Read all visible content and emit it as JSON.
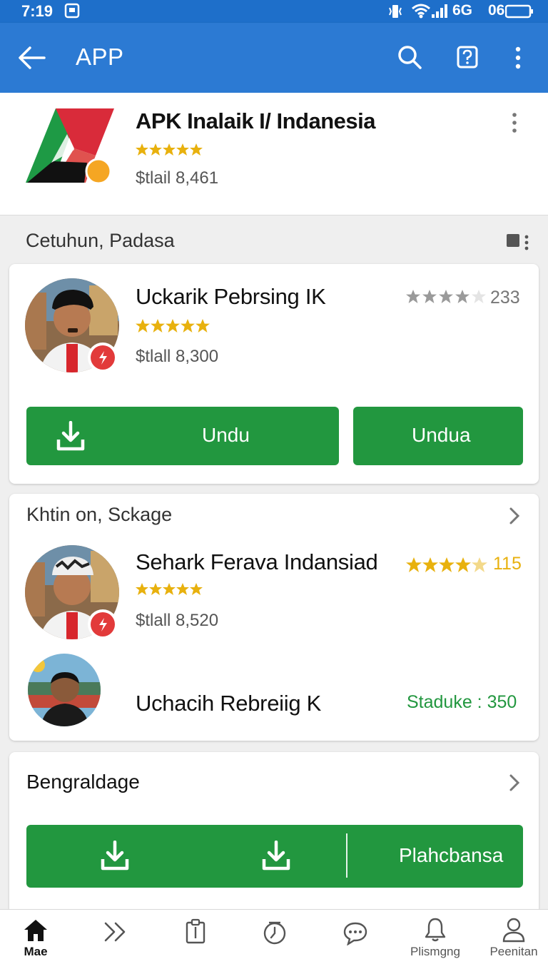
{
  "status_bar": {
    "time": "7:19",
    "signal_text": "6G",
    "battery_text": "06"
  },
  "app_bar": {
    "title": "APP",
    "icons": [
      "back-arrow-icon",
      "search-icon",
      "help-icon",
      "more-vert-icon"
    ]
  },
  "header": {
    "app_name": "APK Inalaik I/ Indanesia",
    "rating": 5,
    "price": "$tlail 8,461"
  },
  "section_label": "Cetuhun, Padasa",
  "card1": {
    "title": "Uckarik Pebrsing IK",
    "rating": 5,
    "price": "$tlall 8,300",
    "rating_count": "233",
    "button_left": "Undu",
    "button_right": "Undua"
  },
  "card2": {
    "header": "Khtin on, Sckage",
    "item1": {
      "title": "Sehark Ferava Indansiad",
      "rating": 5,
      "price": "$tlall 8,520",
      "rating_count": "115"
    },
    "item2": {
      "title": "Uchacih Rebreiig K",
      "status": "Staduke : 350"
    }
  },
  "card3": {
    "header": "Bengraldage",
    "button_label": "Plahcbansa"
  },
  "bottom_nav": [
    {
      "label": "Mae",
      "icon": "home-icon",
      "active": true
    },
    {
      "label": "",
      "icon": "forward-icon"
    },
    {
      "label": "",
      "icon": "clipboard-icon"
    },
    {
      "label": "",
      "icon": "clock-icon"
    },
    {
      "label": "",
      "icon": "chat-icon"
    },
    {
      "label": "Plismgng",
      "icon": "bell-icon"
    },
    {
      "label": "Peenitan",
      "icon": "profile-icon"
    }
  ],
  "colors": {
    "status_bar": "#1e6fca",
    "app_bar": "#2c7ad3",
    "accent_green": "#22973f",
    "star_gold": "#e8b10e",
    "badge_red": "#e23a3a"
  }
}
